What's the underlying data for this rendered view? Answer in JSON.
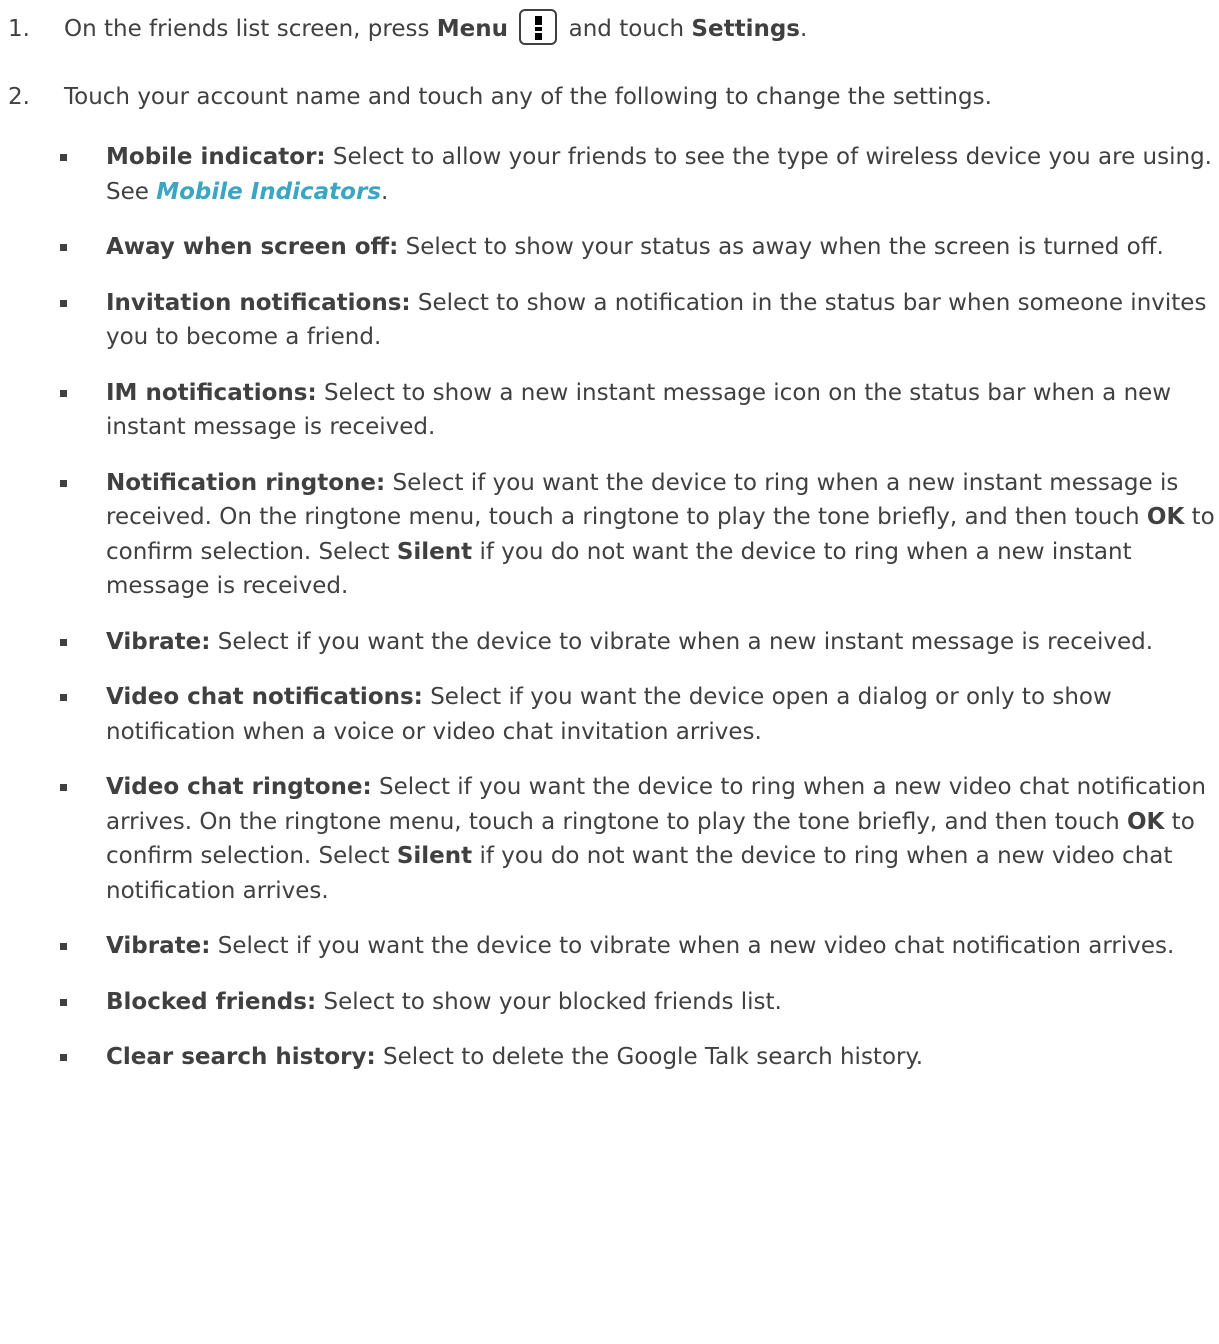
{
  "steps": [
    {
      "num": "1.",
      "pre": "On the friends list screen, press ",
      "b1": "Menu",
      "mid": " and touch ",
      "b2": "Settings",
      "post": "."
    },
    {
      "num": "2.",
      "text": "Touch your account name and touch any of the following to change the settings."
    }
  ],
  "menu_icon": "menu-key-icon",
  "link_color": "#3aa6c4",
  "settings": [
    {
      "label": "Mobile indicator:",
      "text1": " Select to allow your friends to see the type of wireless device you are using. See ",
      "link": "Mobile Indicators",
      "text2": "."
    },
    {
      "label": "Away when screen off:",
      "text1": " Select to show your status as away when the screen is turned off."
    },
    {
      "label": "Invitation notifications:",
      "text1": " Select to show a notification in the status bar when someone invites you to become a friend."
    },
    {
      "label": "IM notifications:",
      "text1": " Select to show a new instant message icon on the status bar when a new instant message is received."
    },
    {
      "label": "Notification ringtone:",
      "text1": " Select if you want the device to ring when a new instant message is received. On the ringtone menu, touch a ringtone to play the tone briefly, and then touch ",
      "b1": "OK",
      "text2": " to confirm selection. Select ",
      "b2": "Silent",
      "text3": " if you do not want the device to ring when a new instant message is received."
    },
    {
      "label": "Vibrate:",
      "text1": " Select if you want the device to vibrate when a new instant message is received."
    },
    {
      "label": "Video chat notifications:",
      "text1": " Select if you want the device open a dialog or only to show notification when a voice or video chat invitation arrives."
    },
    {
      "label": "Video chat ringtone:",
      "text1": " Select if you want the device to ring when a new video chat notification arrives. On the ringtone menu, touch a ringtone to play the tone briefly, and then touch ",
      "b1": "OK",
      "text2": " to confirm selection. Select ",
      "b2": "Silent",
      "text3": " if you do not want the device to ring when a new video chat notification arrives."
    },
    {
      "label": "Vibrate:",
      "text1": " Select if you want the device to vibrate when a new video chat notification arrives."
    },
    {
      "label": "Blocked friends:",
      "text1": " Select to show your blocked friends list."
    },
    {
      "label": "Clear search history:",
      "text1": " Select to delete the Google Talk search history."
    }
  ]
}
